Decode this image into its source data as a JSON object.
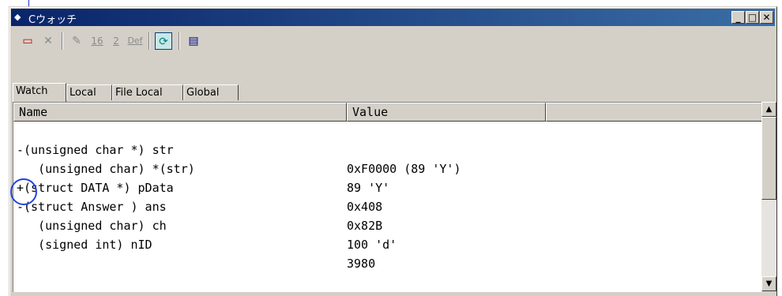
{
  "window": {
    "title": "Cウォッチ",
    "minimize": "_",
    "maximize": "□",
    "close": "✕"
  },
  "toolbar": {
    "buttons": [
      {
        "icon": "add-watch-icon",
        "glyph": "▭"
      },
      {
        "icon": "delete-icon",
        "glyph": "✕"
      },
      {
        "icon": "edit-icon",
        "glyph": "✎"
      },
      {
        "icon": "hex-radix-icon",
        "glyph": "16"
      },
      {
        "icon": "binary-radix-icon",
        "glyph": "2"
      },
      {
        "icon": "default-radix-icon",
        "glyph": "Def"
      },
      {
        "icon": "refresh-icon",
        "glyph": "⟳"
      },
      {
        "icon": "window-icon",
        "glyph": "▤"
      }
    ]
  },
  "tabs": [
    "Watch",
    "Local",
    "File Local",
    "Global"
  ],
  "columns": {
    "name": "Name",
    "value": "Value"
  },
  "rows": [
    {
      "name": "-(unsigned char *) str",
      "value": "0xF0000 (89 'Y')"
    },
    {
      "name": "   (unsigned char) *(str)",
      "value": "89 'Y'"
    },
    {
      "name": "+(struct DATA *) pData",
      "value": "0x408"
    },
    {
      "name": "-(struct Answer ) ans",
      "value": "0x82B"
    },
    {
      "name": "   (unsigned char) ch",
      "value": "100 'd'"
    },
    {
      "name": "   (signed int) nID",
      "value": "3980"
    }
  ],
  "colors": {
    "titlebar_start": "#0a246a",
    "titlebar_end": "#3a6ea5",
    "annotation": "#2244dd"
  }
}
